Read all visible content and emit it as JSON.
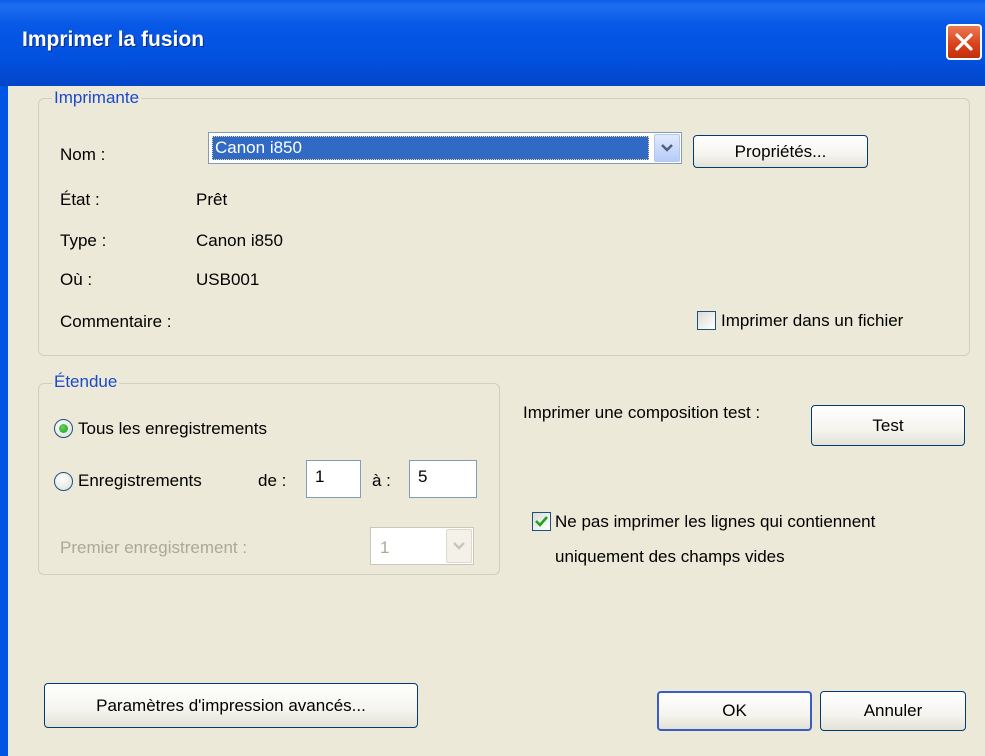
{
  "window": {
    "title": "Imprimer la fusion",
    "close_icon": "close-icon"
  },
  "printer": {
    "legend": "Imprimante",
    "name_label": "Nom :",
    "name_value": "Canon i850",
    "properties_button": "Propriétés...",
    "state_label": "État :",
    "state_value": "Prêt",
    "type_label": "Type :",
    "type_value": "Canon i850",
    "where_label": "Où :",
    "where_value": "USB001",
    "comment_label": "Commentaire :",
    "print_to_file_label": "Imprimer dans un fichier",
    "print_to_file_checked": false
  },
  "range": {
    "legend": "Étendue",
    "all_records_label": "Tous les enregistrements",
    "all_records_selected": true,
    "records_label": "Enregistrements",
    "from_label": "de :",
    "from_value": "1",
    "to_label": "à :",
    "to_value": "5",
    "first_record_label": "Premier enregistrement :",
    "first_record_value": "1"
  },
  "test": {
    "label": "Imprimer une composition test :",
    "button": "Test"
  },
  "skip_blank": {
    "label_line1": "Ne pas imprimer les lignes qui contiennent",
    "label_line2": "uniquement des champs vides",
    "checked": true
  },
  "footer": {
    "advanced_button": "Paramètres d'impression avancés...",
    "ok_button": "OK",
    "cancel_button": "Annuler"
  },
  "colors": {
    "title_bar": "#0350df",
    "dialog_bg": "#ece9d8",
    "legend_text": "#1a4acb",
    "selection": "#316ac5"
  }
}
